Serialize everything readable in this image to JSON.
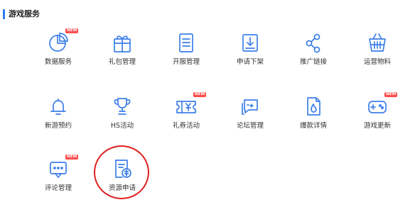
{
  "section": {
    "title": "游戏服务"
  },
  "badge_text": "NEW",
  "accent_color": "#3d7fe9",
  "badge_color": "#ff4d4d",
  "highlight_color": "#e02020",
  "tiles": [
    {
      "label": "数据服务",
      "icon": "pie-chart-icon",
      "badge": true
    },
    {
      "label": "礼包管理",
      "icon": "gift-icon",
      "badge": false
    },
    {
      "label": "开服管理",
      "icon": "document-icon",
      "badge": false
    },
    {
      "label": "申请下架",
      "icon": "download-box-icon",
      "badge": false
    },
    {
      "label": "推广链接",
      "icon": "share-icon",
      "badge": false
    },
    {
      "label": "运营物料",
      "icon": "basket-icon",
      "badge": false
    },
    {
      "label": "新游预约",
      "icon": "bell-icon",
      "badge": false
    },
    {
      "label": "HS活动",
      "icon": "trophy-icon",
      "badge": false
    },
    {
      "label": "礼券活动",
      "icon": "coupon-icon",
      "badge": true
    },
    {
      "label": "论坛管理",
      "icon": "chat-bubbles-icon",
      "badge": false
    },
    {
      "label": "爆款详情",
      "icon": "hot-document-icon",
      "badge": false
    },
    {
      "label": "游戏更新",
      "icon": "gamepad-icon",
      "badge": true
    },
    {
      "label": "评论管理",
      "icon": "comment-icon",
      "badge": true
    },
    {
      "label": "资源申请",
      "icon": "resource-apply-icon",
      "badge": false,
      "highlighted": true
    }
  ]
}
